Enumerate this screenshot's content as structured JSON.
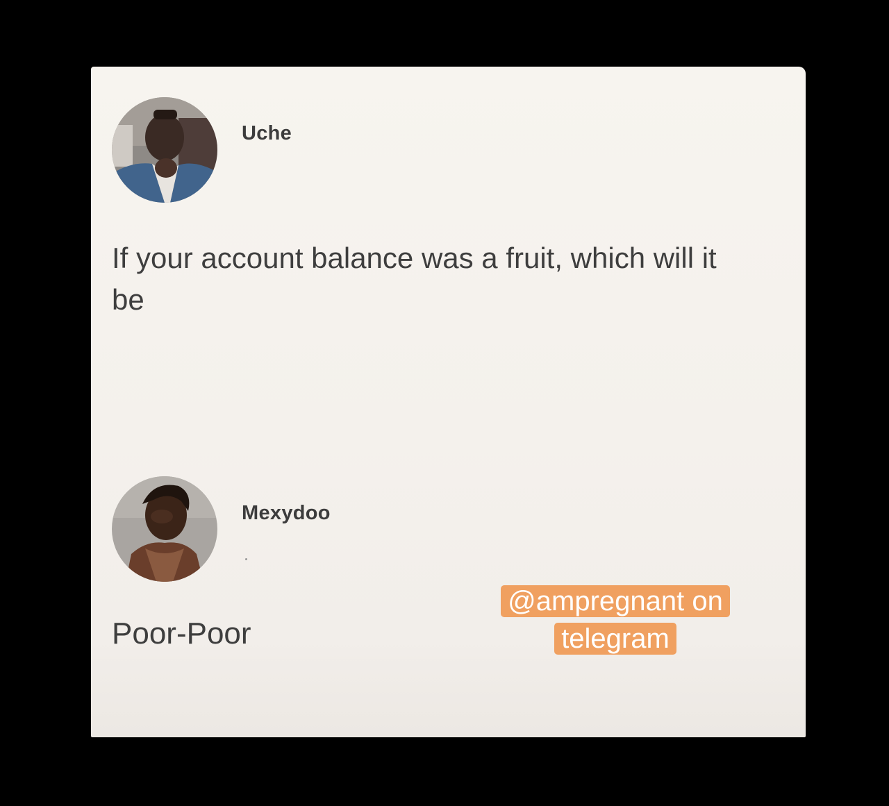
{
  "post": {
    "author": "Uche",
    "avatar_icon": "user-photo-icon",
    "text": "If your account balance was a fruit, which will it be"
  },
  "reply": {
    "author": "Mexydoo",
    "avatar_icon": "user-photo-icon",
    "text": "Poor-Poor"
  },
  "watermark": {
    "text": "@ampregnant on telegram",
    "background_color": "#f0a060"
  },
  "colors": {
    "page_background": "#000000",
    "card_background": "#f7f4ef",
    "text": "#3e3e3e"
  }
}
